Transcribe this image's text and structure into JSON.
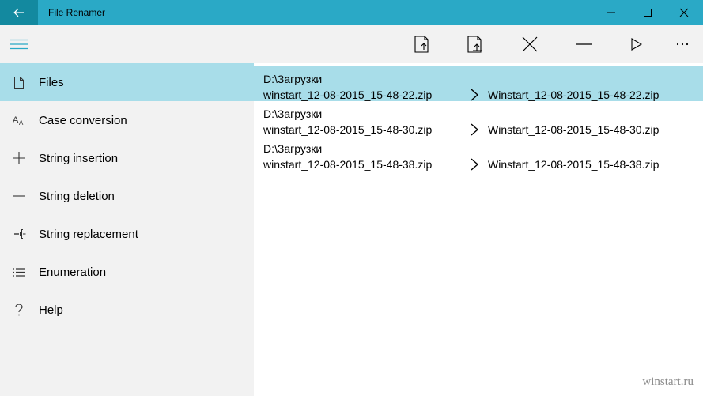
{
  "window": {
    "title": "File Renamer",
    "accent_color": "#2aa9c6",
    "back_button_color": "#13899f",
    "selected_color": "#a8dde9"
  },
  "sidebar": {
    "menu_icon": "hamburger-icon",
    "items": [
      {
        "label": "Files",
        "icon": "document-icon",
        "selected": true
      },
      {
        "label": "Case conversion",
        "icon": "case-conversion-icon",
        "selected": false
      },
      {
        "label": "String insertion",
        "icon": "plus-icon",
        "selected": false
      },
      {
        "label": "String deletion",
        "icon": "minus-icon",
        "selected": false
      },
      {
        "label": "String replacement",
        "icon": "replace-icon",
        "selected": false
      },
      {
        "label": "Enumeration",
        "icon": "list-icon",
        "selected": false
      },
      {
        "label": "Help",
        "icon": "question-icon",
        "selected": false
      }
    ]
  },
  "toolbar": {
    "buttons": [
      {
        "name": "add-file-button",
        "icon": "add-file-icon"
      },
      {
        "name": "add-folder-button",
        "icon": "add-folder-icon"
      },
      {
        "name": "remove-button",
        "icon": "close-icon"
      },
      {
        "name": "clear-button",
        "icon": "minus-icon"
      },
      {
        "name": "run-button",
        "icon": "play-icon"
      },
      {
        "name": "more-button",
        "icon": "more-icon"
      }
    ]
  },
  "files": [
    {
      "folder": "D:\\Загрузки",
      "source": "winstart_12-08-2015_15-48-22.zip",
      "target": "Winstart_12-08-2015_15-48-22.zip",
      "selected": true
    },
    {
      "folder": "D:\\Загрузки",
      "source": "winstart_12-08-2015_15-48-30.zip",
      "target": "Winstart_12-08-2015_15-48-30.zip",
      "selected": false
    },
    {
      "folder": "D:\\Загрузки",
      "source": "winstart_12-08-2015_15-48-38.zip",
      "target": "Winstart_12-08-2015_15-48-38.zip",
      "selected": false
    }
  ],
  "watermark": "winstart.ru"
}
